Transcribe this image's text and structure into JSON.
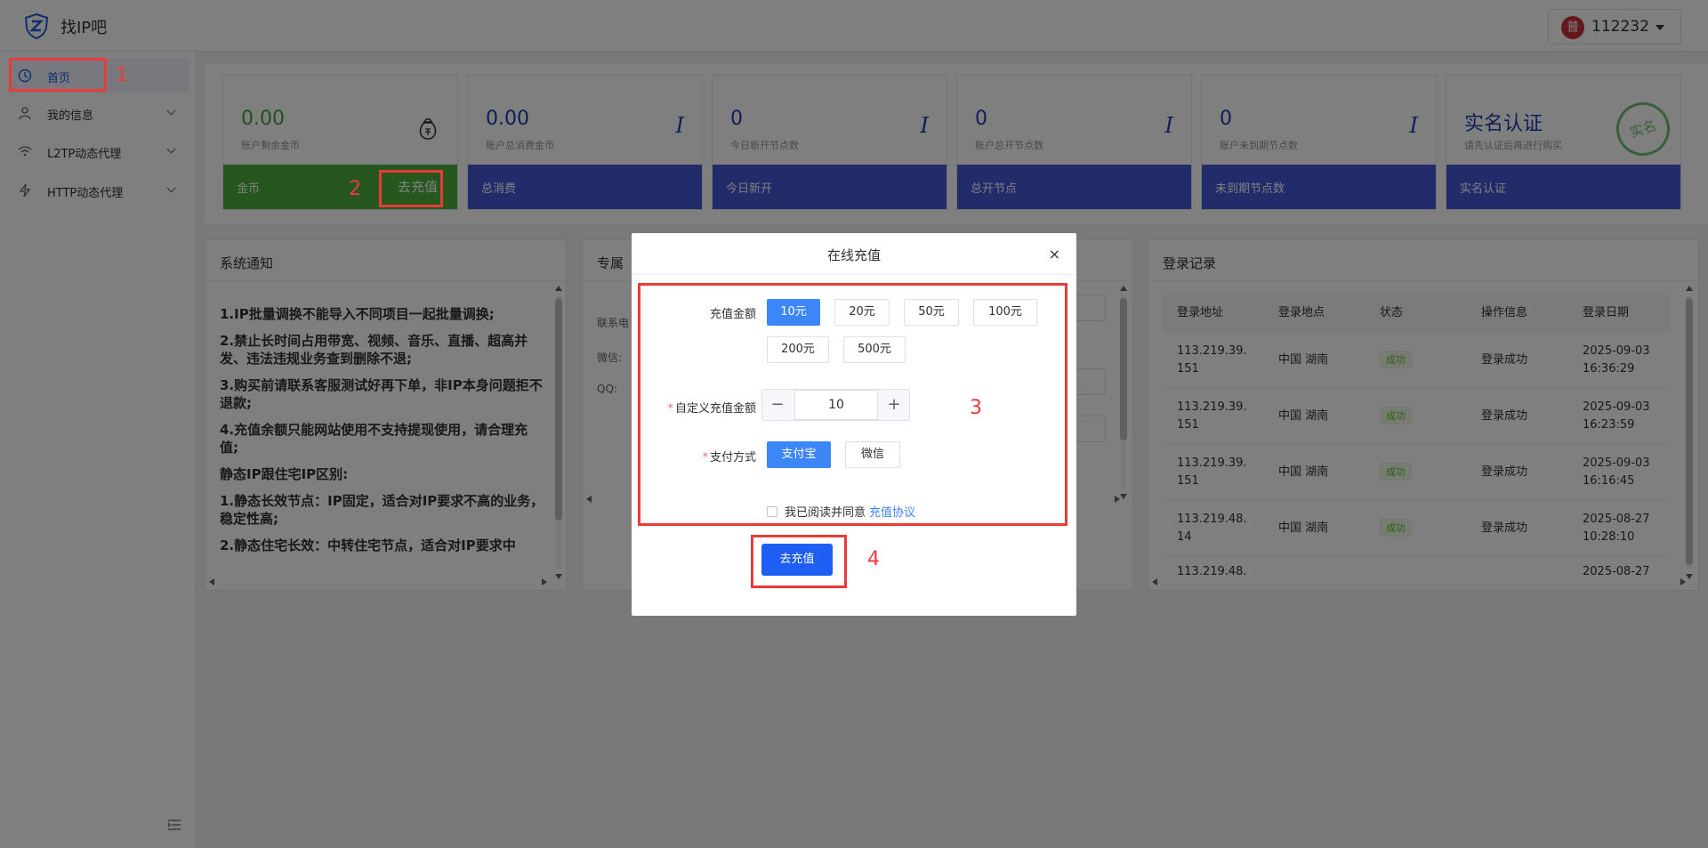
{
  "header": {
    "brand": "找IP吧",
    "user_avatar_char": "普",
    "user_name": "112232"
  },
  "sidebar": {
    "items": [
      {
        "label": "首页",
        "icon": "home-icon",
        "active": true
      },
      {
        "label": "我的信息",
        "icon": "user-icon"
      },
      {
        "label": "L2TP动态代理",
        "icon": "wifi-icon"
      },
      {
        "label": "HTTP动态代理",
        "icon": "lightning-icon"
      }
    ]
  },
  "stats": [
    {
      "value": "0.00",
      "label": "账户剩余金币",
      "bar": "金币",
      "action": "去充值"
    },
    {
      "value": "0.00",
      "label": "账户总消费金币",
      "bar": "总消费",
      "mark": "I"
    },
    {
      "value": "0",
      "label": "今日新开节点数",
      "bar": "今日新开",
      "mark": "I"
    },
    {
      "value": "0",
      "label": "账户总开节点数",
      "bar": "总开节点",
      "mark": "I"
    },
    {
      "value": "0",
      "label": "账户未到期节点数",
      "bar": "未到期节点数",
      "mark": "I"
    },
    {
      "value": "实名认证",
      "label": "请先认证后再进行购买",
      "bar": "实名认证",
      "seal": "实名"
    }
  ],
  "notice": {
    "title": "系统通知",
    "lines": [
      "1.IP批量调换不能导入不同项目一起批量调换;",
      "2.禁止长时间占用带宽、视频、音乐、直播、超高并发、违法违规业务查到删除不退;",
      "3.购买前请联系客服测试好再下单，非IP本身问题拒不退款;",
      "4.充值余额只能网站使用不支持提现使用，请合理充值;",
      "静态IP跟住宅IP区别:",
      "1.静态长效节点：IP固定，适合对IP要求不高的业务，稳定性高;",
      "2.静态住宅长效：中转住宅节点，适合对IP要求中"
    ]
  },
  "contact": {
    "title_partial": "专属",
    "labels": [
      "联系电",
      "微信:",
      "QQ:"
    ]
  },
  "login_records": {
    "title": "登录记录",
    "columns": [
      "登录地址",
      "登录地点",
      "状态",
      "操作信息",
      "登录日期"
    ],
    "rows": [
      {
        "addr1": "113.219.39.",
        "addr2": "151",
        "place": "中国 湖南",
        "status": "成功",
        "info": "登录成功",
        "date": "2025-09-03",
        "time": "16:36:29"
      },
      {
        "addr1": "113.219.39.",
        "addr2": "151",
        "place": "中国 湖南",
        "status": "成功",
        "info": "登录成功",
        "date": "2025-09-03",
        "time": "16:23:59"
      },
      {
        "addr1": "113.219.39.",
        "addr2": "151",
        "place": "中国 湖南",
        "status": "成功",
        "info": "登录成功",
        "date": "2025-09-03",
        "time": "16:16:45"
      },
      {
        "addr1": "113.219.48.",
        "addr2": "14",
        "place": "中国 湖南",
        "status": "成功",
        "info": "登录成功",
        "date": "2025-08-27",
        "time": "10:28:10"
      },
      {
        "addr1": "113.219.48.",
        "addr2": "",
        "place": "",
        "status": "",
        "info": "",
        "date": "2025-08-27",
        "time": ""
      }
    ]
  },
  "dialog": {
    "title": "在线充值",
    "close": "×",
    "amount_label": "充值金额",
    "amounts": [
      "10元",
      "20元",
      "50元",
      "100元",
      "200元",
      "500元"
    ],
    "selected_amount": "10元",
    "custom_label": "自定义充值金额",
    "custom_value": "10",
    "minus": "−",
    "plus": "+",
    "pay_label": "支付方式",
    "pay_methods": [
      "支付宝",
      "微信"
    ],
    "selected_pay": "支付宝",
    "agree_text": "我已阅读并同意",
    "agree_link": "充值协议",
    "submit": "去充值",
    "required_mark": "*"
  },
  "annotations": [
    "1",
    "2",
    "3",
    "4"
  ],
  "colors": {
    "accent": "#3d86f7",
    "primary": "#1e5ef5",
    "bar_blue": "#4558d6",
    "bar_green": "#4caf3f",
    "annotation": "#ea3b3b"
  }
}
